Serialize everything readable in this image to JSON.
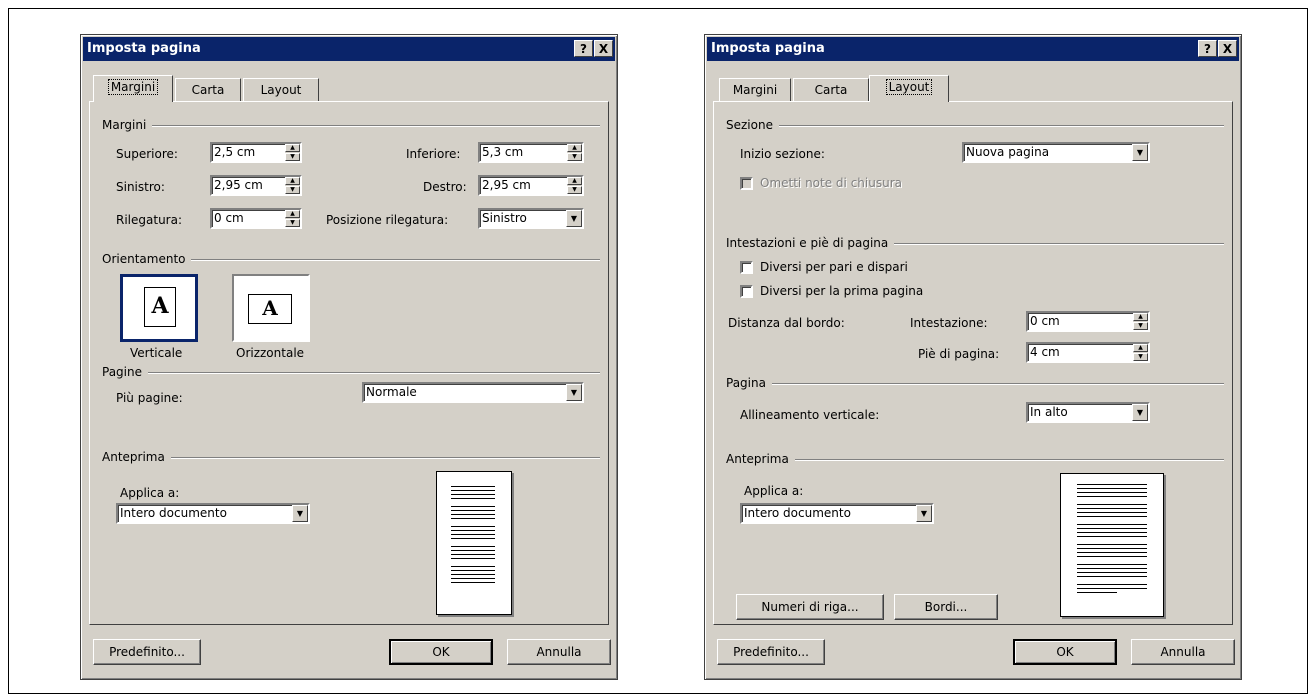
{
  "left_dialog": {
    "title": "Imposta pagina",
    "help_btn": "?",
    "close_btn": "X",
    "tabs": [
      "Margini",
      "Carta",
      "Layout"
    ],
    "active_tab": "Margini",
    "margins_group": "Margini",
    "superiore_label": "Superiore:",
    "superiore_value": "2,5 cm",
    "inferiore_label": "Inferiore:",
    "inferiore_value": "5,3 cm",
    "sinistro_label": "Sinistro:",
    "sinistro_value": "2,95 cm",
    "destro_label": "Destro:",
    "destro_value": "2,95 cm",
    "rilegatura_label": "Rilegatura:",
    "rilegatura_value": "0 cm",
    "pos_rilegatura_label": "Posizione rilegatura:",
    "pos_rilegatura_value": "Sinistro",
    "orient_group": "Orientamento",
    "verticale_label": "Verticale",
    "orizzontale_label": "Orizzontale",
    "orient_glyph": "A",
    "pagine_group": "Pagine",
    "piu_pagine_label": "Più pagine:",
    "piu_pagine_value": "Normale",
    "anteprima_group": "Anteprima",
    "applica_label": "Applica a:",
    "applica_value": "Intero documento",
    "predefinito_btn": "Predefinito...",
    "ok_btn": "OK",
    "annulla_btn": "Annulla"
  },
  "right_dialog": {
    "title": "Imposta pagina",
    "help_btn": "?",
    "close_btn": "X",
    "tabs": [
      "Margini",
      "Carta",
      "Layout"
    ],
    "active_tab": "Layout",
    "sezione_group": "Sezione",
    "inizio_label": "Inizio sezione:",
    "inizio_value": "Nuova pagina",
    "ometti_label": "Ometti note di chiusura",
    "intestazioni_group": "Intestazioni e piè di pagina",
    "diversi_pari_label": "Diversi per pari e dispari",
    "diversi_prima_label": "Diversi per la prima pagina",
    "distanza_label": "Distanza dal bordo:",
    "intestazione_label": "Intestazione:",
    "intestazione_value": "0 cm",
    "pie_label": "Piè di pagina:",
    "pie_value": "4 cm",
    "pagina_group": "Pagina",
    "allineamento_label": "Allineamento verticale:",
    "allineamento_value": "In alto",
    "anteprima_group": "Anteprima",
    "applica_label": "Applica a:",
    "applica_value": "Intero documento",
    "numeri_btn": "Numeri di riga...",
    "bordi_btn": "Bordi...",
    "predefinito_btn": "Predefinito...",
    "ok_btn": "OK",
    "annulla_btn": "Annulla"
  }
}
